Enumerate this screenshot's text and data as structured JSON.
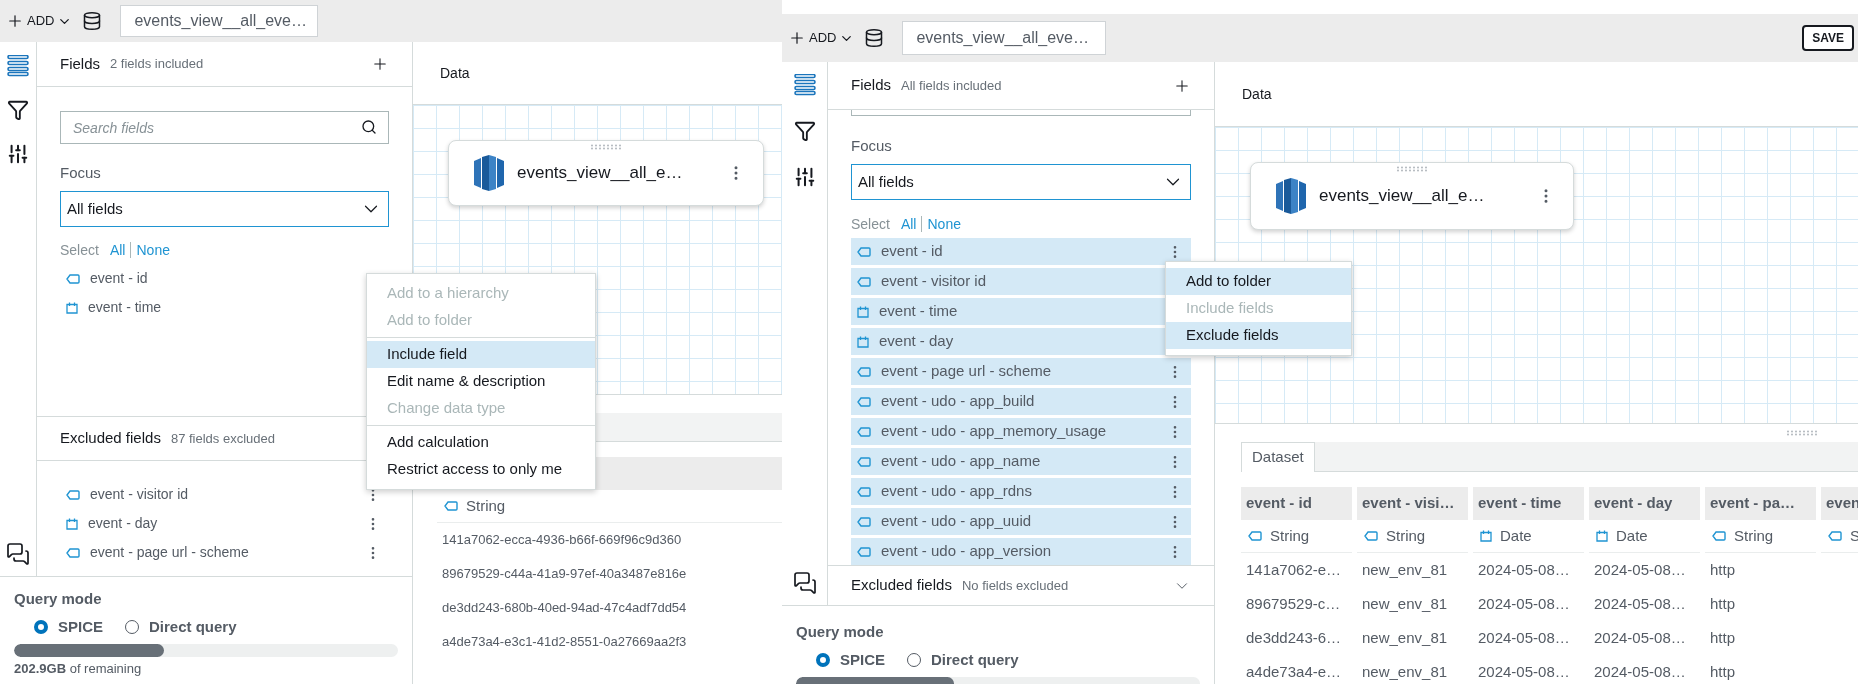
{
  "screens": [
    {
      "topbar": {
        "add_label": "ADD",
        "dataset_name": "events_view__all_eve…"
      },
      "rail": [
        {
          "kind": "fields",
          "selected": true
        },
        {
          "kind": "filter",
          "selected": false
        },
        {
          "kind": "parameters",
          "selected": false
        }
      ],
      "fields_panel": {
        "title": "Fields",
        "summary": "2 fields included",
        "search_placeholder": "Search fields",
        "focus_label": "Focus",
        "focus_value": "All fields",
        "select_label": "Select",
        "select_all": "All",
        "select_none": "None",
        "items": [
          {
            "label": "event - id",
            "kind": "string",
            "selected": false,
            "kebab": false
          },
          {
            "label": "event - time",
            "kind": "date",
            "selected": false,
            "kebab": false
          }
        ]
      },
      "excluded": {
        "title": "Excluded fields",
        "summary": "87 fields excluded",
        "expanded": true,
        "items": [
          {
            "label": "event - visitor id",
            "kind": "string",
            "selected": false,
            "kebab": true
          },
          {
            "label": "event - day",
            "kind": "date",
            "selected": false,
            "kebab": true
          },
          {
            "label": "event - page url - scheme",
            "kind": "string",
            "selected": false,
            "kebab": true
          }
        ]
      },
      "query_mode": {
        "title": "Query mode",
        "options": [
          {
            "label": "SPICE",
            "selected": true
          },
          {
            "label": "Direct query",
            "selected": false
          }
        ],
        "level": 0.39,
        "storage": "**202.9GB** of remaining"
      },
      "data_panel": {
        "title": "Data",
        "card_name": "events_view__all_e…",
        "table": {
          "columns": [
            {
              "type": "String",
              "kind": "string"
            }
          ],
          "rows": [
            [
              "141a7062-ecca-4936-b66f-669f96c9d360"
            ],
            [
              "89679529-c44a-41a9-97ef-40a3487e816e"
            ],
            [
              "de3dd243-680b-40ed-94ad-47c4adf7dd54"
            ],
            [
              "a4de73a4-e3c1-41d2-8551-0a27669aa2f3"
            ]
          ]
        }
      },
      "context_menu": [
        {
          "label": "Add to a hierarchy",
          "disabled": true,
          "highlighted": false,
          "divider_before": false
        },
        {
          "label": "Add to folder",
          "disabled": true,
          "highlighted": false,
          "divider_before": false
        },
        {
          "label": "Include field",
          "disabled": false,
          "highlighted": true,
          "divider_before": true
        },
        {
          "label": "Edit name & description",
          "disabled": false,
          "highlighted": false,
          "divider_before": false
        },
        {
          "label": "Change data type",
          "disabled": true,
          "highlighted": false,
          "divider_before": false
        },
        {
          "label": "Add calculation",
          "disabled": false,
          "highlighted": false,
          "divider_before": true
        },
        {
          "label": "Restrict access to only me",
          "disabled": false,
          "highlighted": false,
          "divider_before": false
        }
      ]
    },
    {
      "topbar": {
        "add_label": "ADD",
        "dataset_name": "events_view__all_eve…",
        "save_label": "SAVE"
      },
      "rail": [
        {
          "kind": "fields",
          "selected": true
        },
        {
          "kind": "filter",
          "selected": false
        },
        {
          "kind": "parameters",
          "selected": false
        }
      ],
      "fields_panel": {
        "title": "Fields",
        "summary": "All fields included",
        "focus_label": "Focus",
        "focus_value": "All fields",
        "select_label": "Select",
        "select_all": "All",
        "select_none": "None",
        "items": [
          {
            "label": "event - id",
            "kind": "string",
            "selected": true,
            "kebab": true
          },
          {
            "label": "event - visitor id",
            "kind": "string",
            "selected": true,
            "kebab": false
          },
          {
            "label": "event - time",
            "kind": "date",
            "selected": true,
            "kebab": false
          },
          {
            "label": "event - day",
            "kind": "date",
            "selected": true,
            "kebab": false
          },
          {
            "label": "event - page url - scheme",
            "kind": "string",
            "selected": true,
            "kebab": true
          },
          {
            "label": "event - udo - app_build",
            "kind": "string",
            "selected": true,
            "kebab": true
          },
          {
            "label": "event - udo - app_memory_usage",
            "kind": "string",
            "selected": true,
            "kebab": true
          },
          {
            "label": "event - udo - app_name",
            "kind": "string",
            "selected": true,
            "kebab": true
          },
          {
            "label": "event - udo - app_rdns",
            "kind": "string",
            "selected": true,
            "kebab": true
          },
          {
            "label": "event - udo - app_uuid",
            "kind": "string",
            "selected": true,
            "kebab": true
          },
          {
            "label": "event - udo - app_version",
            "kind": "string",
            "selected": true,
            "kebab": true
          }
        ]
      },
      "excluded": {
        "title": "Excluded fields",
        "summary": "No fields excluded",
        "expanded": false
      },
      "query_mode": {
        "title": "Query mode",
        "options": [
          {
            "label": "SPICE",
            "selected": true
          },
          {
            "label": "Direct query",
            "selected": false
          }
        ],
        "level": 0.39
      },
      "data_panel": {
        "title": "Data",
        "card_name": "events_view__all_e…",
        "table": {
          "tab": "Dataset",
          "columns": [
            {
              "name": "event - id",
              "type": "String",
              "kind": "string"
            },
            {
              "name": "event - visi…",
              "type": "String",
              "kind": "string"
            },
            {
              "name": "event - time",
              "type": "Date",
              "kind": "date"
            },
            {
              "name": "event - day",
              "type": "Date",
              "kind": "date"
            },
            {
              "name": "event - pa…",
              "type": "String",
              "kind": "string"
            },
            {
              "name": "even",
              "type": "S",
              "kind": "string"
            }
          ],
          "rows": [
            [
              "141a7062-e…",
              "new_env_81",
              "2024-05-08…",
              "2024-05-08…",
              "http"
            ],
            [
              "89679529-c…",
              "new_env_81",
              "2024-05-08…",
              "2024-05-08…",
              "http"
            ],
            [
              "de3dd243-6…",
              "new_env_81",
              "2024-05-08…",
              "2024-05-08…",
              "http"
            ],
            [
              "a4de73a4-e…",
              "new_env_81",
              "2024-05-08…",
              "2024-05-08…",
              "http"
            ]
          ]
        }
      },
      "context_menu": [
        {
          "label": "Add to folder",
          "disabled": false,
          "highlighted": true,
          "divider_before": false
        },
        {
          "label": "Include fields",
          "disabled": true,
          "highlighted": false,
          "divider_before": false
        },
        {
          "label": "Exclude fields",
          "disabled": false,
          "highlighted": true,
          "divider_before": false
        }
      ]
    }
  ]
}
